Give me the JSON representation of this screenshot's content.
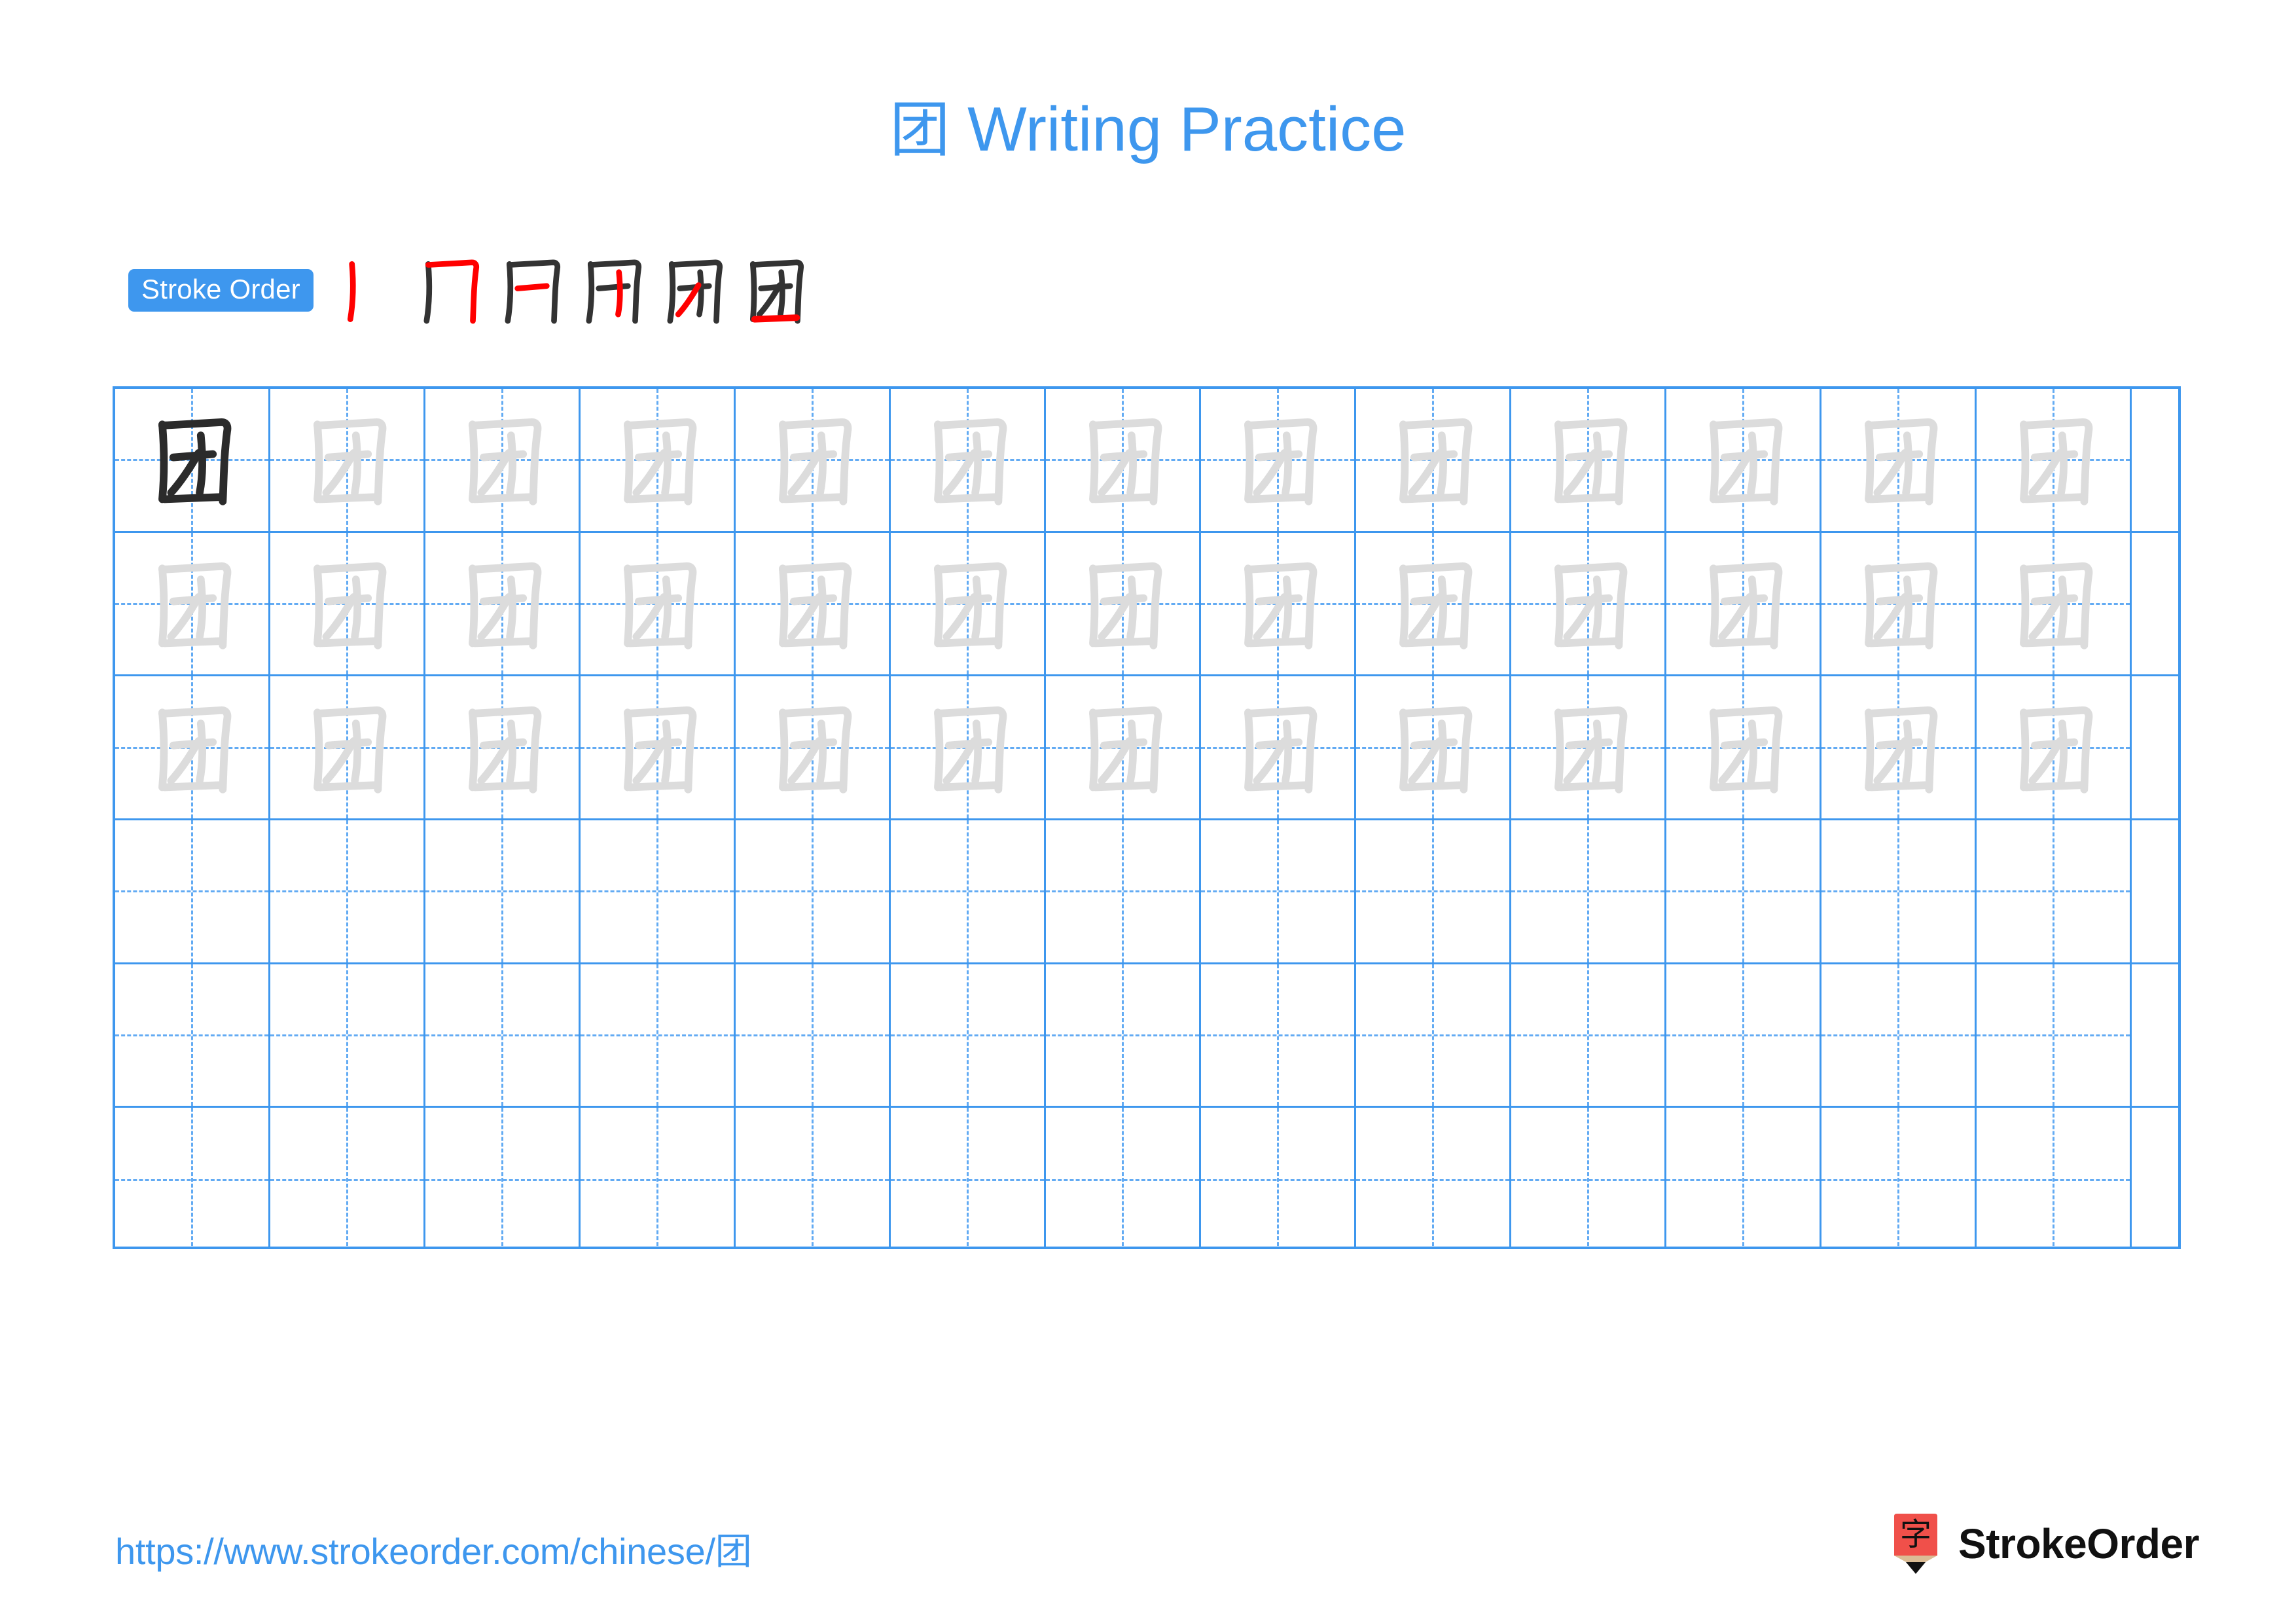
{
  "page": {
    "character": "团",
    "title_suffix": "Writing Practice",
    "title_full": "团 Writing Practice",
    "background_color": "#ffffff",
    "accent_color": "#3e97ee",
    "grid_line_color": "#3e97ee",
    "grid_dash_color": "#63abf3",
    "trace_color": "#dcdcdc",
    "model_color": "#2b2b2b",
    "highlight_stroke_color": "#ff0000",
    "ink_color": "#333333"
  },
  "stroke_order": {
    "badge_label": "Stroke Order",
    "badge_bg": "#3e97ee",
    "badge_text_color": "#ffffff",
    "stroke_count": 6,
    "steps": [
      {
        "index": 1,
        "name": "stroke-step-1",
        "strokes_drawn": 1,
        "new_stroke": "丨"
      },
      {
        "index": 2,
        "name": "stroke-step-2",
        "strokes_drawn": 2,
        "new_stroke": "乛"
      },
      {
        "index": 3,
        "name": "stroke-step-3",
        "strokes_drawn": 3,
        "new_stroke": "一"
      },
      {
        "index": 4,
        "name": "stroke-step-4",
        "strokes_drawn": 4,
        "new_stroke": "丨"
      },
      {
        "index": 5,
        "name": "stroke-step-5",
        "strokes_drawn": 5,
        "new_stroke": "丿"
      },
      {
        "index": 6,
        "name": "stroke-step-6",
        "strokes_drawn": 6,
        "new_stroke": "一"
      }
    ]
  },
  "practice_grid": {
    "rows": 6,
    "columns": 13,
    "cell_size_px": 237,
    "rows_data": [
      {
        "row": 1,
        "type": "model-and-trace",
        "cells": [
          "model",
          "trace",
          "trace",
          "trace",
          "trace",
          "trace",
          "trace",
          "trace",
          "trace",
          "trace",
          "trace",
          "trace",
          "trace"
        ]
      },
      {
        "row": 2,
        "type": "trace",
        "cells": [
          "trace",
          "trace",
          "trace",
          "trace",
          "trace",
          "trace",
          "trace",
          "trace",
          "trace",
          "trace",
          "trace",
          "trace",
          "trace"
        ]
      },
      {
        "row": 3,
        "type": "trace",
        "cells": [
          "trace",
          "trace",
          "trace",
          "trace",
          "trace",
          "trace",
          "trace",
          "trace",
          "trace",
          "trace",
          "trace",
          "trace",
          "trace"
        ]
      },
      {
        "row": 4,
        "type": "blank",
        "cells": [
          "blank",
          "blank",
          "blank",
          "blank",
          "blank",
          "blank",
          "blank",
          "blank",
          "blank",
          "blank",
          "blank",
          "blank",
          "blank"
        ]
      },
      {
        "row": 5,
        "type": "blank",
        "cells": [
          "blank",
          "blank",
          "blank",
          "blank",
          "blank",
          "blank",
          "blank",
          "blank",
          "blank",
          "blank",
          "blank",
          "blank",
          "blank"
        ]
      },
      {
        "row": 6,
        "type": "blank",
        "cells": [
          "blank",
          "blank",
          "blank",
          "blank",
          "blank",
          "blank",
          "blank",
          "blank",
          "blank",
          "blank",
          "blank",
          "blank",
          "blank"
        ]
      }
    ]
  },
  "footer": {
    "url": "https://www.strokeorder.com/chinese/团",
    "brand_name": "StrokeOrder",
    "logo_char": "字",
    "logo_body_color": "#f0504a",
    "logo_wood_color": "#dbbc95",
    "logo_tip_color": "#111111"
  }
}
